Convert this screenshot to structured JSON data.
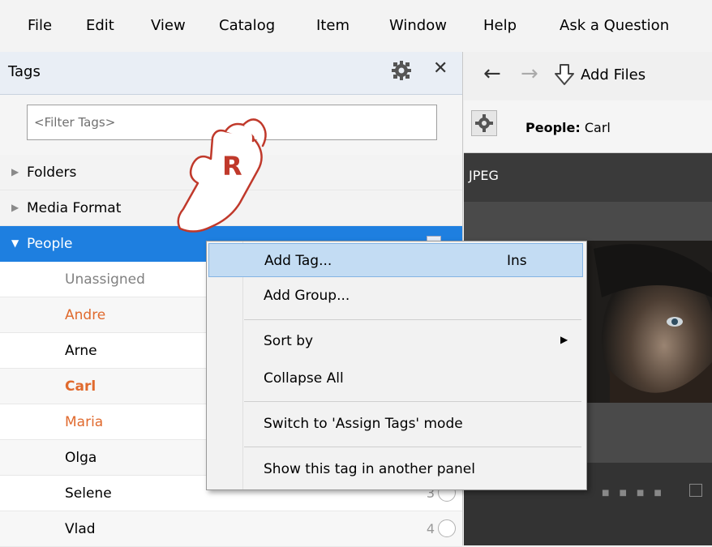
{
  "menubar": {
    "items": [
      "File",
      "Edit",
      "View",
      "Catalog",
      "Item",
      "Window",
      "Help",
      "Ask a Question"
    ]
  },
  "tags_panel": {
    "title": "Tags",
    "filter_placeholder": "<Filter Tags>",
    "groups": [
      {
        "label": "Folders",
        "arrow": "▶",
        "selected": false
      },
      {
        "label": "Media Format",
        "arrow": "▶",
        "selected": false
      },
      {
        "label": "People",
        "arrow": "▼",
        "selected": true
      }
    ],
    "people": [
      {
        "label": "Unassigned",
        "color": "#808080",
        "count": ""
      },
      {
        "label": "Andre",
        "color": "#e06a2e",
        "count": ""
      },
      {
        "label": "Arne",
        "color": "#000000",
        "count": ""
      },
      {
        "label": "Carl",
        "color": "#e06a2e",
        "count": ""
      },
      {
        "label": "Maria",
        "color": "#e06a2e",
        "count": ""
      },
      {
        "label": "Olga",
        "color": "#000000",
        "count": ""
      },
      {
        "label": "Selene",
        "color": "#000000",
        "count": "3"
      },
      {
        "label": "Vlad",
        "color": "#000000",
        "count": "4"
      }
    ]
  },
  "toolbar": {
    "add_files_label": "Add Files"
  },
  "filterbar": {
    "key": "People:",
    "value": "Carl"
  },
  "browser": {
    "format_label": "JPEG"
  },
  "context_menu": {
    "items": [
      {
        "label": "Add Tag...",
        "shortcut": "Ins",
        "highlighted": true
      },
      {
        "label": "Add Group...",
        "shortcut": ""
      },
      {
        "label": "Sort by",
        "shortcut": "",
        "submenu": true
      },
      {
        "label": "Collapse All",
        "shortcut": ""
      },
      {
        "label": "Switch to 'Assign Tags' mode",
        "shortcut": ""
      },
      {
        "label": "Show this tag in another panel",
        "shortcut": ""
      }
    ]
  },
  "annotation": {
    "badge_letter": "R"
  }
}
